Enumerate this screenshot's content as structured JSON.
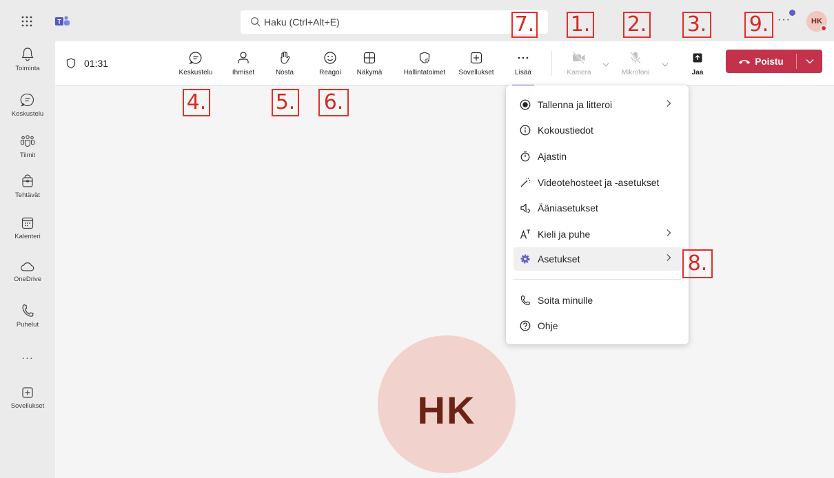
{
  "search": {
    "placeholder": "Haku (Ctrl+Alt+E)"
  },
  "user": {
    "initials": "HK"
  },
  "rail": {
    "items": [
      {
        "label": "Toiminta",
        "icon": "bell-icon"
      },
      {
        "label": "Keskustelu",
        "icon": "chat-icon"
      },
      {
        "label": "Tiimit",
        "icon": "teams-icon"
      },
      {
        "label": "Tehtävät",
        "icon": "tasks-icon"
      },
      {
        "label": "Kalenteri",
        "icon": "calendar-icon"
      },
      {
        "label": "OneDrive",
        "icon": "cloud-icon"
      },
      {
        "label": "Puhelut",
        "icon": "phone-icon"
      },
      {
        "label": "Sovellukset",
        "icon": "add-apps-icon"
      }
    ]
  },
  "meeting": {
    "timer": "01:31",
    "toolbar": {
      "chat": "Keskustelu",
      "people": "Ihmiset",
      "raise": "Nosta",
      "react": "Reagoi",
      "view": "Näkymä",
      "host": "Hallintatoimet",
      "apps": "Sovellukset",
      "more": "Lisää",
      "camera": "Kamera",
      "mic": "Mikrofoni",
      "share": "Jaa",
      "leave": "Poistu"
    }
  },
  "menu": {
    "items": [
      {
        "label": "Tallenna ja litteroi",
        "icon": "record-icon",
        "submenu": true
      },
      {
        "label": "Kokoustiedot",
        "icon": "info-icon",
        "submenu": false
      },
      {
        "label": "Ajastin",
        "icon": "timer-icon",
        "submenu": false
      },
      {
        "label": "Videotehosteet ja -asetukset",
        "icon": "magic-wand-icon",
        "submenu": false
      },
      {
        "label": "Ääniasetukset",
        "icon": "speaker-settings-icon",
        "submenu": false
      },
      {
        "label": "Kieli ja puhe",
        "icon": "language-icon",
        "submenu": true
      },
      {
        "label": "Asetukset",
        "icon": "gear-icon",
        "submenu": true
      },
      {
        "label": "Soita minulle",
        "icon": "phone-icon",
        "submenu": false
      },
      {
        "label": "Ohje",
        "icon": "help-icon",
        "submenu": false
      }
    ]
  },
  "annotations": {
    "camera": "1.",
    "mic": "2.",
    "share": "3.",
    "chat": "4.",
    "raise": "5.",
    "react": "6.",
    "more": "7.",
    "settings": "8.",
    "leave": "9."
  },
  "colors": {
    "accent": "#5b5fc7",
    "leave": "#c4314b",
    "annotation": "#e0302b",
    "avatar_bg": "#f1d2cc"
  }
}
